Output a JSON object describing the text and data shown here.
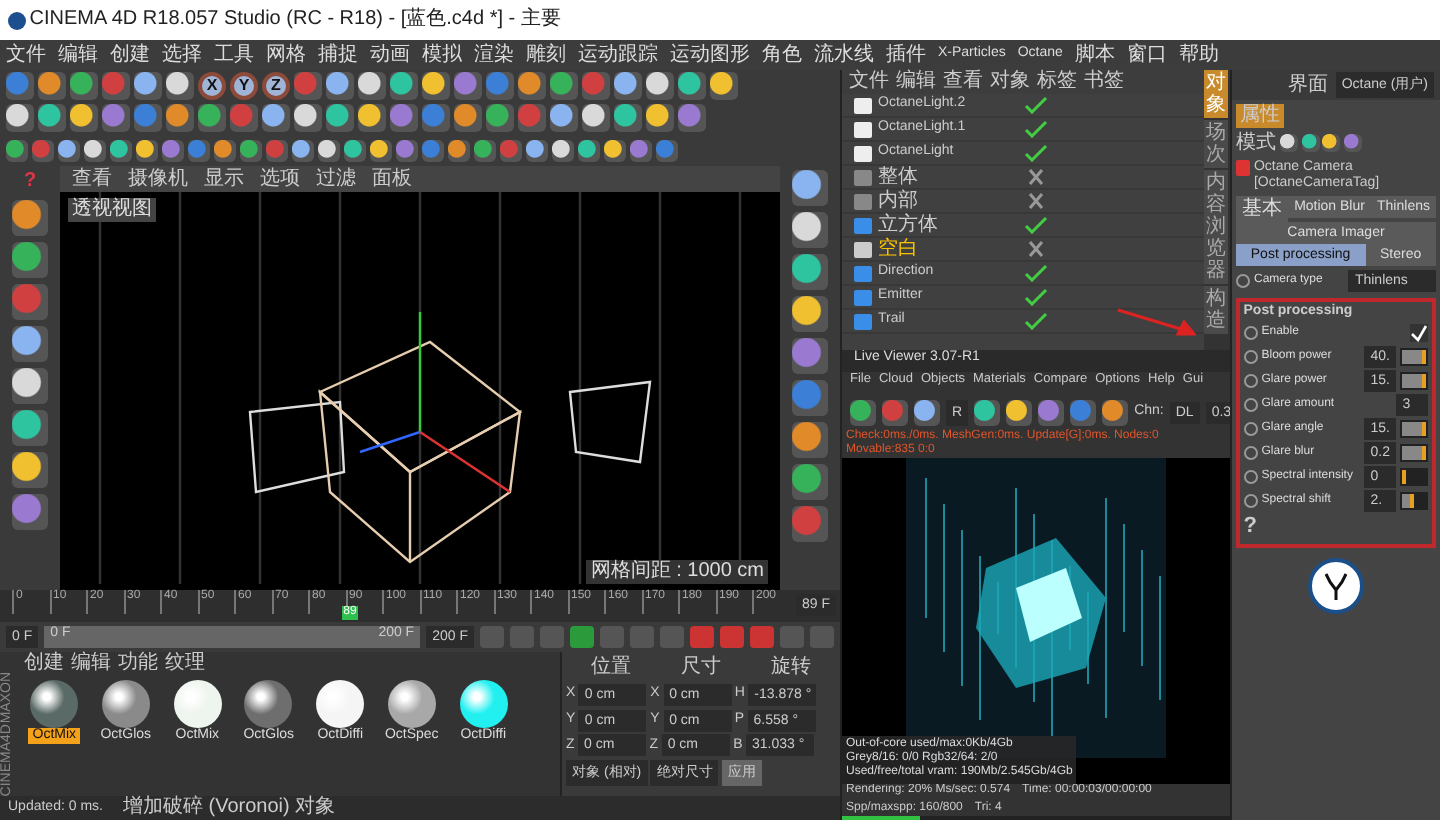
{
  "window": {
    "title": "CINEMA 4D R18.057 Studio (RC - R18) - [蓝色.c4d *] - 主要"
  },
  "menu": [
    "文件",
    "编辑",
    "创建",
    "选择",
    "工具",
    "网格",
    "捕捉",
    "动画",
    "模拟",
    "渲染",
    "雕刻",
    "运动跟踪",
    "运动图形",
    "角色",
    "流水线",
    "插件",
    "X-Particles",
    "Octane",
    "脚本",
    "窗口",
    "帮助"
  ],
  "layout": {
    "label": "界面",
    "value": "Octane (用户)"
  },
  "toolbar": {
    "axis_buttons": [
      {
        "label": "X",
        "on": true
      },
      {
        "label": "Y",
        "on": true
      },
      {
        "label": "Z",
        "on": true
      }
    ]
  },
  "viewport": {
    "menu": [
      "查看",
      "摄像机",
      "显示",
      "选项",
      "过滤",
      "面板"
    ],
    "title": "透视视图",
    "grid_info": "网格间距 : 1000 cm",
    "help": "?"
  },
  "timeline": {
    "ticks": [
      "0",
      "10",
      "20",
      "30",
      "40",
      "50",
      "60",
      "70",
      "80",
      "90",
      "100",
      "110",
      "120",
      "130",
      "140",
      "150",
      "160",
      "170",
      "180",
      "190",
      "200"
    ],
    "playhead": {
      "label": "89",
      "level": 0.445
    },
    "current_frame": "89 F"
  },
  "transport": {
    "start": "0 F",
    "range_start": "0 F",
    "range_end": "200 F",
    "end": "200 F",
    "range_slider": {
      "level": 1
    }
  },
  "materials": {
    "menu": [
      "创建",
      "编辑",
      "功能",
      "纹理"
    ],
    "items": [
      {
        "name": "OctMix",
        "selected": true,
        "color": "#5a6a66"
      },
      {
        "name": "OctGlos",
        "selected": false,
        "color": "#8a8a8a"
      },
      {
        "name": "OctMix",
        "selected": false,
        "color": "#eef4ee"
      },
      {
        "name": "OctGlos",
        "selected": false,
        "color": "#6e6e6e"
      },
      {
        "name": "OctDiffi",
        "selected": false,
        "color": "#f5f5f5"
      },
      {
        "name": "OctSpec",
        "selected": false,
        "color": "#a8a8a8"
      },
      {
        "name": "OctDiffi",
        "selected": false,
        "color": "#22f0f0"
      }
    ]
  },
  "brand": [
    "MAXON",
    "CINEMA4D"
  ],
  "coordinates": {
    "headers": [
      "位置",
      "尺寸",
      "旋转"
    ],
    "rows": [
      {
        "cells": [
          {
            "axis": "X",
            "value": "0 cm"
          },
          {
            "axis": "X",
            "value": "0 cm"
          },
          {
            "axis": "H",
            "value": "-13.878 °"
          }
        ]
      },
      {
        "cells": [
          {
            "axis": "Y",
            "value": "0 cm"
          },
          {
            "axis": "Y",
            "value": "0 cm"
          },
          {
            "axis": "P",
            "value": "6.558 °"
          }
        ]
      },
      {
        "cells": [
          {
            "axis": "Z",
            "value": "0 cm"
          },
          {
            "axis": "Z",
            "value": "0 cm"
          },
          {
            "axis": "B",
            "value": "31.033 °"
          }
        ]
      }
    ],
    "mode": "对象 (相对)",
    "size_mode": "绝对尺寸",
    "apply": "应用"
  },
  "status_bar": {
    "time": "Updated: 0 ms.",
    "message": "增加破碎 (Voronoi) 对象"
  },
  "object_manager": {
    "menu": [
      "文件",
      "编辑",
      "查看",
      "对象",
      "标签",
      "书签"
    ],
    "objects": [
      {
        "name": "OctaneLight.2",
        "kind": "light",
        "selected": false,
        "checked": true
      },
      {
        "name": "OctaneLight.1",
        "kind": "light",
        "selected": false,
        "checked": true
      },
      {
        "name": "OctaneLight",
        "kind": "light",
        "selected": false,
        "checked": true
      },
      {
        "name": "整体",
        "kind": "camera",
        "selected": false,
        "checked": false
      },
      {
        "name": "内部",
        "kind": "camera",
        "selected": false,
        "checked": false
      },
      {
        "name": "立方体",
        "kind": "cube",
        "selected": false,
        "checked": true
      },
      {
        "name": "空白",
        "kind": "null",
        "selected": true,
        "checked": false
      },
      {
        "name": "Direction",
        "kind": "emitter",
        "selected": false,
        "checked": true
      },
      {
        "name": "Emitter",
        "kind": "emitter",
        "selected": false,
        "checked": true
      },
      {
        "name": "Trail",
        "kind": "emitter",
        "selected": false,
        "checked": true
      }
    ]
  },
  "side_tabs": [
    {
      "label": "对象",
      "selected": true
    },
    {
      "label": "场次",
      "selected": false
    },
    {
      "label": "内容浏览器",
      "selected": false
    },
    {
      "label": "构造",
      "selected": false
    }
  ],
  "attributes": {
    "header": "属性",
    "mode": "模式",
    "title": "Octane Camera [OctaneCameraTag]",
    "tabs": [
      {
        "label": "基本",
        "selected": false
      },
      {
        "label": "Motion Blur",
        "selected": false
      },
      {
        "label": "Thinlens",
        "selected": false
      },
      {
        "label": "Camera Imager",
        "selected": false
      },
      {
        "label": "Post processing",
        "selected": true
      },
      {
        "label": "Stereo",
        "selected": false
      }
    ],
    "camera_type": {
      "label": "Camera type",
      "value": "Thinlens"
    },
    "section": "Post processing",
    "highlighted": true,
    "params": [
      {
        "label": "Enable",
        "kind": "checkbox",
        "checked": true
      },
      {
        "label": "Bloom power",
        "kind": "slider",
        "value": "40.",
        "level": 1
      },
      {
        "label": "Glare power",
        "kind": "slider",
        "value": "15.",
        "level": 1
      },
      {
        "label": "Glare amount",
        "kind": "number",
        "value": "3"
      },
      {
        "label": "Glare angle",
        "kind": "slider",
        "value": "15.",
        "level": 1
      },
      {
        "label": "Glare blur",
        "kind": "slider",
        "value": "0.2",
        "level": 1
      },
      {
        "label": "Spectral intensity",
        "kind": "slider",
        "value": "0",
        "level": 0
      },
      {
        "label": "Spectral shift",
        "kind": "slider",
        "value": "2.",
        "level": 0.5
      }
    ],
    "help": "?"
  },
  "annotation_arrow": true,
  "live_viewer": {
    "title": "Live Viewer 3.07-R1",
    "menu": [
      "File",
      "Cloud",
      "Objects",
      "Materials",
      "Compare",
      "Options",
      "Help",
      "Gui"
    ],
    "render_button": "R",
    "channel": {
      "label": "Chn:",
      "value": "DL"
    },
    "zoom": "0.3",
    "check_line": "Check:0ms./0ms. MeshGen:0ms. Update[G]:0ms. Nodes:0 Movable:835 0:0",
    "stats": [
      "Out-of-core used/max:0Kb/4Gb",
      "Grey8/16: 0/0       Rgb32/64: 2/0",
      "Used/free/total vram: 190Mb/2.545Gb/4Gb"
    ],
    "status": [
      "Rendering: 20%  Ms/sec: 0.574",
      "Time: 00:00:03/00:00:00",
      "Spp/maxspp: 160/800",
      "Tri: 4"
    ],
    "progress": {
      "level": 0.2
    }
  }
}
